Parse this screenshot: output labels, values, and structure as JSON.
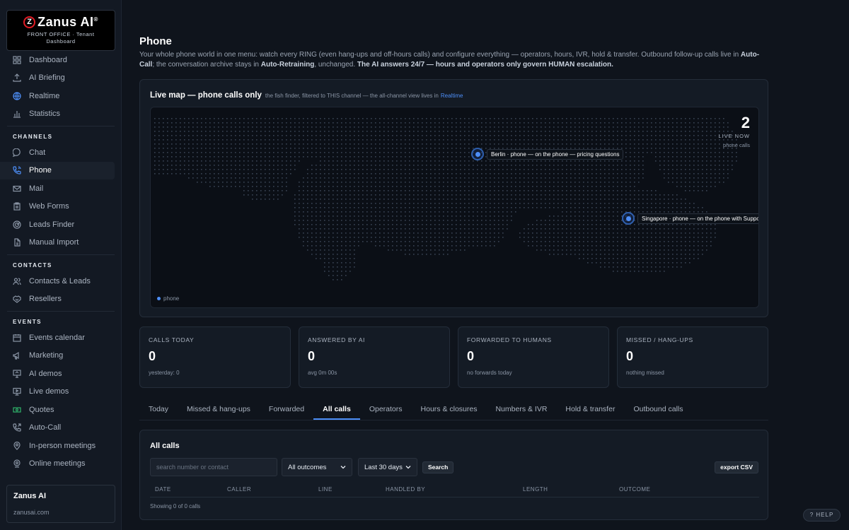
{
  "brand": {
    "logo_letter": "Z",
    "name": "Zanus AI",
    "trademark": "®",
    "subtitle_line1": "FRONT OFFICE · Tenant",
    "subtitle_line2": "Dashboard"
  },
  "sidebar": {
    "top_items": [
      {
        "label": "Dashboard",
        "icon": "grid-icon"
      },
      {
        "label": "AI Briefing",
        "icon": "upload-icon"
      },
      {
        "label": "Realtime",
        "icon": "globe-icon"
      },
      {
        "label": "Statistics",
        "icon": "bar-chart-icon"
      }
    ],
    "channels_title": "CHANNELS",
    "channels": [
      {
        "label": "Chat",
        "icon": "chat-bubble-icon"
      },
      {
        "label": "Phone",
        "icon": "phone-icon",
        "active": true
      },
      {
        "label": "Mail",
        "icon": "mail-icon"
      },
      {
        "label": "Web Forms",
        "icon": "clipboard-icon"
      },
      {
        "label": "Leads Finder",
        "icon": "radar-icon"
      },
      {
        "label": "Manual Import",
        "icon": "file-import-icon"
      }
    ],
    "contacts_title": "CONTACTS",
    "contacts": [
      {
        "label": "Contacts & Leads",
        "icon": "users-icon"
      },
      {
        "label": "Resellers",
        "icon": "handshake-icon"
      }
    ],
    "events_title": "EVENTS",
    "events": [
      {
        "label": "Events calendar",
        "icon": "calendar-icon"
      },
      {
        "label": "Marketing",
        "icon": "megaphone-icon"
      },
      {
        "label": "AI demos",
        "icon": "presentation-icon"
      },
      {
        "label": "Live demos",
        "icon": "monitor-icon"
      },
      {
        "label": "Quotes",
        "icon": "banknote-icon"
      },
      {
        "label": "Auto-Call",
        "icon": "phone-outgoing-icon"
      },
      {
        "label": "In-person meetings",
        "icon": "map-pin-icon"
      },
      {
        "label": "Online meetings",
        "icon": "webcam-icon"
      }
    ],
    "footer": {
      "title": "Zanus AI",
      "url": "zanusai.com"
    }
  },
  "page": {
    "title": "Phone",
    "desc_1": "Your whole phone world in one menu: watch every RING (even hang-ups and off-hours calls) and configure everything — operators, hours, IVR, hold & transfer. Outbound follow-up calls live in ",
    "desc_b1": "Auto-Call",
    "desc_2": "; the conversation archive stays in ",
    "desc_b2": "Auto-Retraining",
    "desc_3": ", unchanged. ",
    "desc_b3": "The AI answers 24/7 — hours and operators only govern HUMAN escalation."
  },
  "live_map": {
    "title": "Live map — phone calls only",
    "subtitle": "the fish finder, filtered to THIS channel — the all-channel view lives in",
    "link": "Realtime",
    "live_count": "2",
    "live_label": "LIVE NOW",
    "live_sub": "phone calls",
    "pins": [
      {
        "label": "Berlin · phone — on the phone — pricing questions"
      },
      {
        "label": "Singapore · phone — on the phone with Support"
      }
    ],
    "legend": "phone",
    "accent": "#4d8ef7"
  },
  "stats": [
    {
      "label": "CALLS TODAY",
      "value": "0",
      "sub": "yesterday: 0"
    },
    {
      "label": "ANSWERED BY AI",
      "value": "0",
      "sub": "avg 0m 00s"
    },
    {
      "label": "FORWARDED TO HUMANS",
      "value": "0",
      "sub": "no forwards today"
    },
    {
      "label": "MISSED / HANG-UPS",
      "value": "0",
      "sub": "nothing missed"
    }
  ],
  "tabs": [
    {
      "label": "Today"
    },
    {
      "label": "Missed & hang-ups"
    },
    {
      "label": "Forwarded"
    },
    {
      "label": "All calls",
      "active": true
    },
    {
      "label": "Operators"
    },
    {
      "label": "Hours & closures"
    },
    {
      "label": "Numbers & IVR"
    },
    {
      "label": "Hold & transfer"
    },
    {
      "label": "Outbound calls"
    }
  ],
  "calls": {
    "title": "All calls",
    "search_placeholder": "search number or contact",
    "outcome_filter": "All outcomes",
    "range_filter": "Last 30 days",
    "search_button": "Search",
    "export_button": "export CSV",
    "columns": [
      "DATE",
      "CALLER",
      "LINE",
      "HANDLED BY",
      "LENGTH",
      "OUTCOME"
    ],
    "showing": "Showing 0 of 0 calls"
  },
  "help_button": "? HELP"
}
